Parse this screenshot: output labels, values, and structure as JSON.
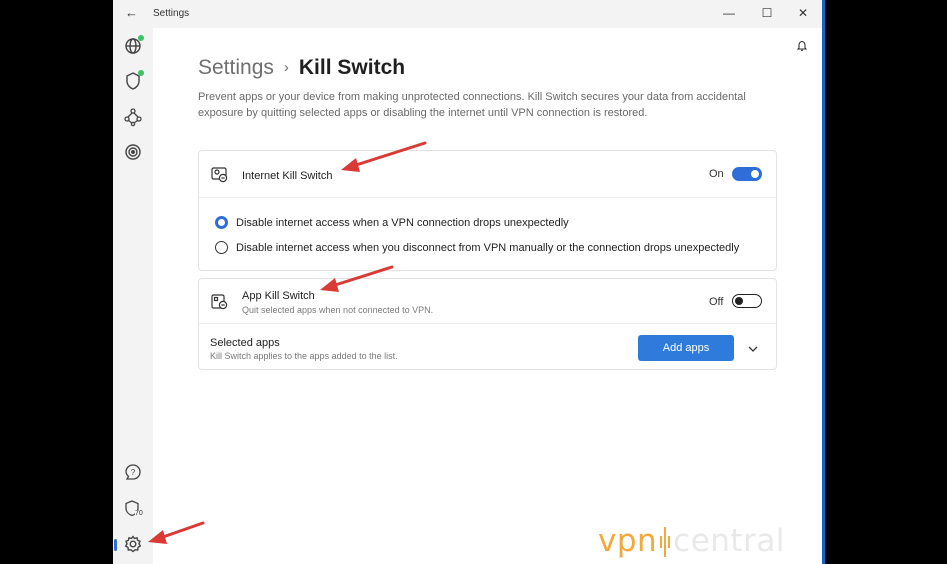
{
  "window": {
    "title": "Settings",
    "back_glyph": "←",
    "controls": {
      "minimize": "—",
      "maximize": "☐",
      "close": "✕"
    }
  },
  "sidebar": {
    "items": [
      {
        "name": "globe-icon",
        "badge": "connected",
        "badge_color": "#3ac463"
      },
      {
        "name": "shield-icon",
        "badge": "connected",
        "badge_color": "#3ac463"
      },
      {
        "name": "mesh-network-icon"
      },
      {
        "name": "target-icon"
      }
    ],
    "bottom_items": [
      {
        "name": "help-icon"
      },
      {
        "name": "shield-score-icon",
        "value": "70"
      },
      {
        "name": "gear-icon",
        "active": true
      }
    ]
  },
  "header": {
    "bell_icon": "bell-icon",
    "breadcrumb_parent": "Settings",
    "breadcrumb_separator": "›",
    "page_title": "Kill Switch",
    "description": "Prevent apps or your device from making unprotected connections. Kill Switch secures your data from accidental exposure by quitting selected apps or disabling the internet until VPN connection is restored."
  },
  "internet_kill_switch": {
    "title": "Internet Kill Switch",
    "toggle_label": "On",
    "enabled": true,
    "options": [
      {
        "label": "Disable internet access when a VPN connection drops unexpectedly",
        "selected": true
      },
      {
        "label": "Disable internet access when you disconnect from VPN manually or the connection drops unexpectedly",
        "selected": false
      }
    ]
  },
  "app_kill_switch": {
    "title": "App Kill Switch",
    "subtitle": "Quit selected apps when not connected to VPN.",
    "toggle_label": "Off",
    "enabled": false,
    "selected_apps_title": "Selected apps",
    "selected_apps_subtitle": "Kill Switch applies to the apps added to the list.",
    "add_button": "Add apps"
  },
  "watermark": {
    "part1": "vpn",
    "part2": "central"
  },
  "colors": {
    "accent": "#2f6ed9",
    "annotation": "#d93a35",
    "watermark_orange": "#f2a93b"
  }
}
